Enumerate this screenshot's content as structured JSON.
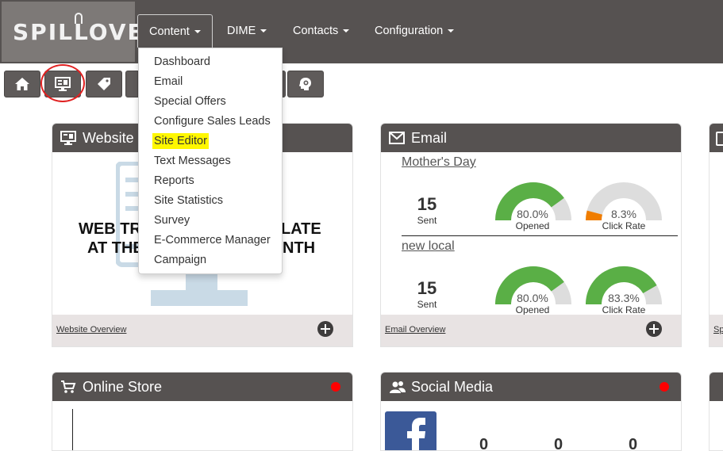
{
  "app": {
    "logo_text": "SPILLOVER"
  },
  "nav": {
    "items": [
      {
        "label": "Content"
      },
      {
        "label": "DIME"
      },
      {
        "label": "Contacts"
      },
      {
        "label": "Configuration"
      }
    ]
  },
  "dropdown": {
    "items": [
      {
        "label": "Dashboard"
      },
      {
        "label": "Email"
      },
      {
        "label": "Special Offers"
      },
      {
        "label": "Configure Sales Leads"
      },
      {
        "label": "Site Editor"
      },
      {
        "label": "Text Messages"
      },
      {
        "label": "Reports"
      },
      {
        "label": "Site Statistics"
      },
      {
        "label": "Survey"
      },
      {
        "label": "E-Commerce Manager"
      },
      {
        "label": "Campaign"
      }
    ],
    "highlight_color": "#fff700"
  },
  "toolbar": {
    "icons": [
      "home-icon",
      "monitor-icon",
      "tag-icon",
      "lightbulb-head-icon"
    ]
  },
  "website_card": {
    "title": "Website",
    "line1_left": "WEB TR",
    "line1_right": "LATE",
    "line2_left": "AT THE",
    "line2_right": "NTH",
    "footer_link": "Website Overview"
  },
  "email_card": {
    "title": "Email",
    "footer_link": "Email Overview",
    "campaigns": [
      {
        "name": "Mother's Day",
        "sent": "15",
        "sent_label": "Sent",
        "opened": "80.0%",
        "opened_label": "Opened",
        "opened_fraction": 0.8,
        "click_rate": "8.3%",
        "click_label": "Click Rate",
        "click_fraction": 0.083
      },
      {
        "name": "new local",
        "sent": "15",
        "sent_label": "Sent",
        "opened": "80.0%",
        "opened_label": "Opened",
        "opened_fraction": 0.8,
        "click_rate": "83.3%",
        "click_label": "Click Rate",
        "click_fraction": 0.833
      }
    ]
  },
  "third_card": {
    "footer_link": "Sp"
  },
  "store_card": {
    "title": "Online Store",
    "status_color": "#ff0000"
  },
  "social_card": {
    "title": "Social Media",
    "counts": [
      "0",
      "0",
      "0"
    ],
    "status_color": "#ff0000"
  },
  "colors": {
    "header": "#565251",
    "gauge_green": "#5aaf46",
    "gauge_orange": "#f07d00",
    "gauge_gray": "#dddddd"
  }
}
